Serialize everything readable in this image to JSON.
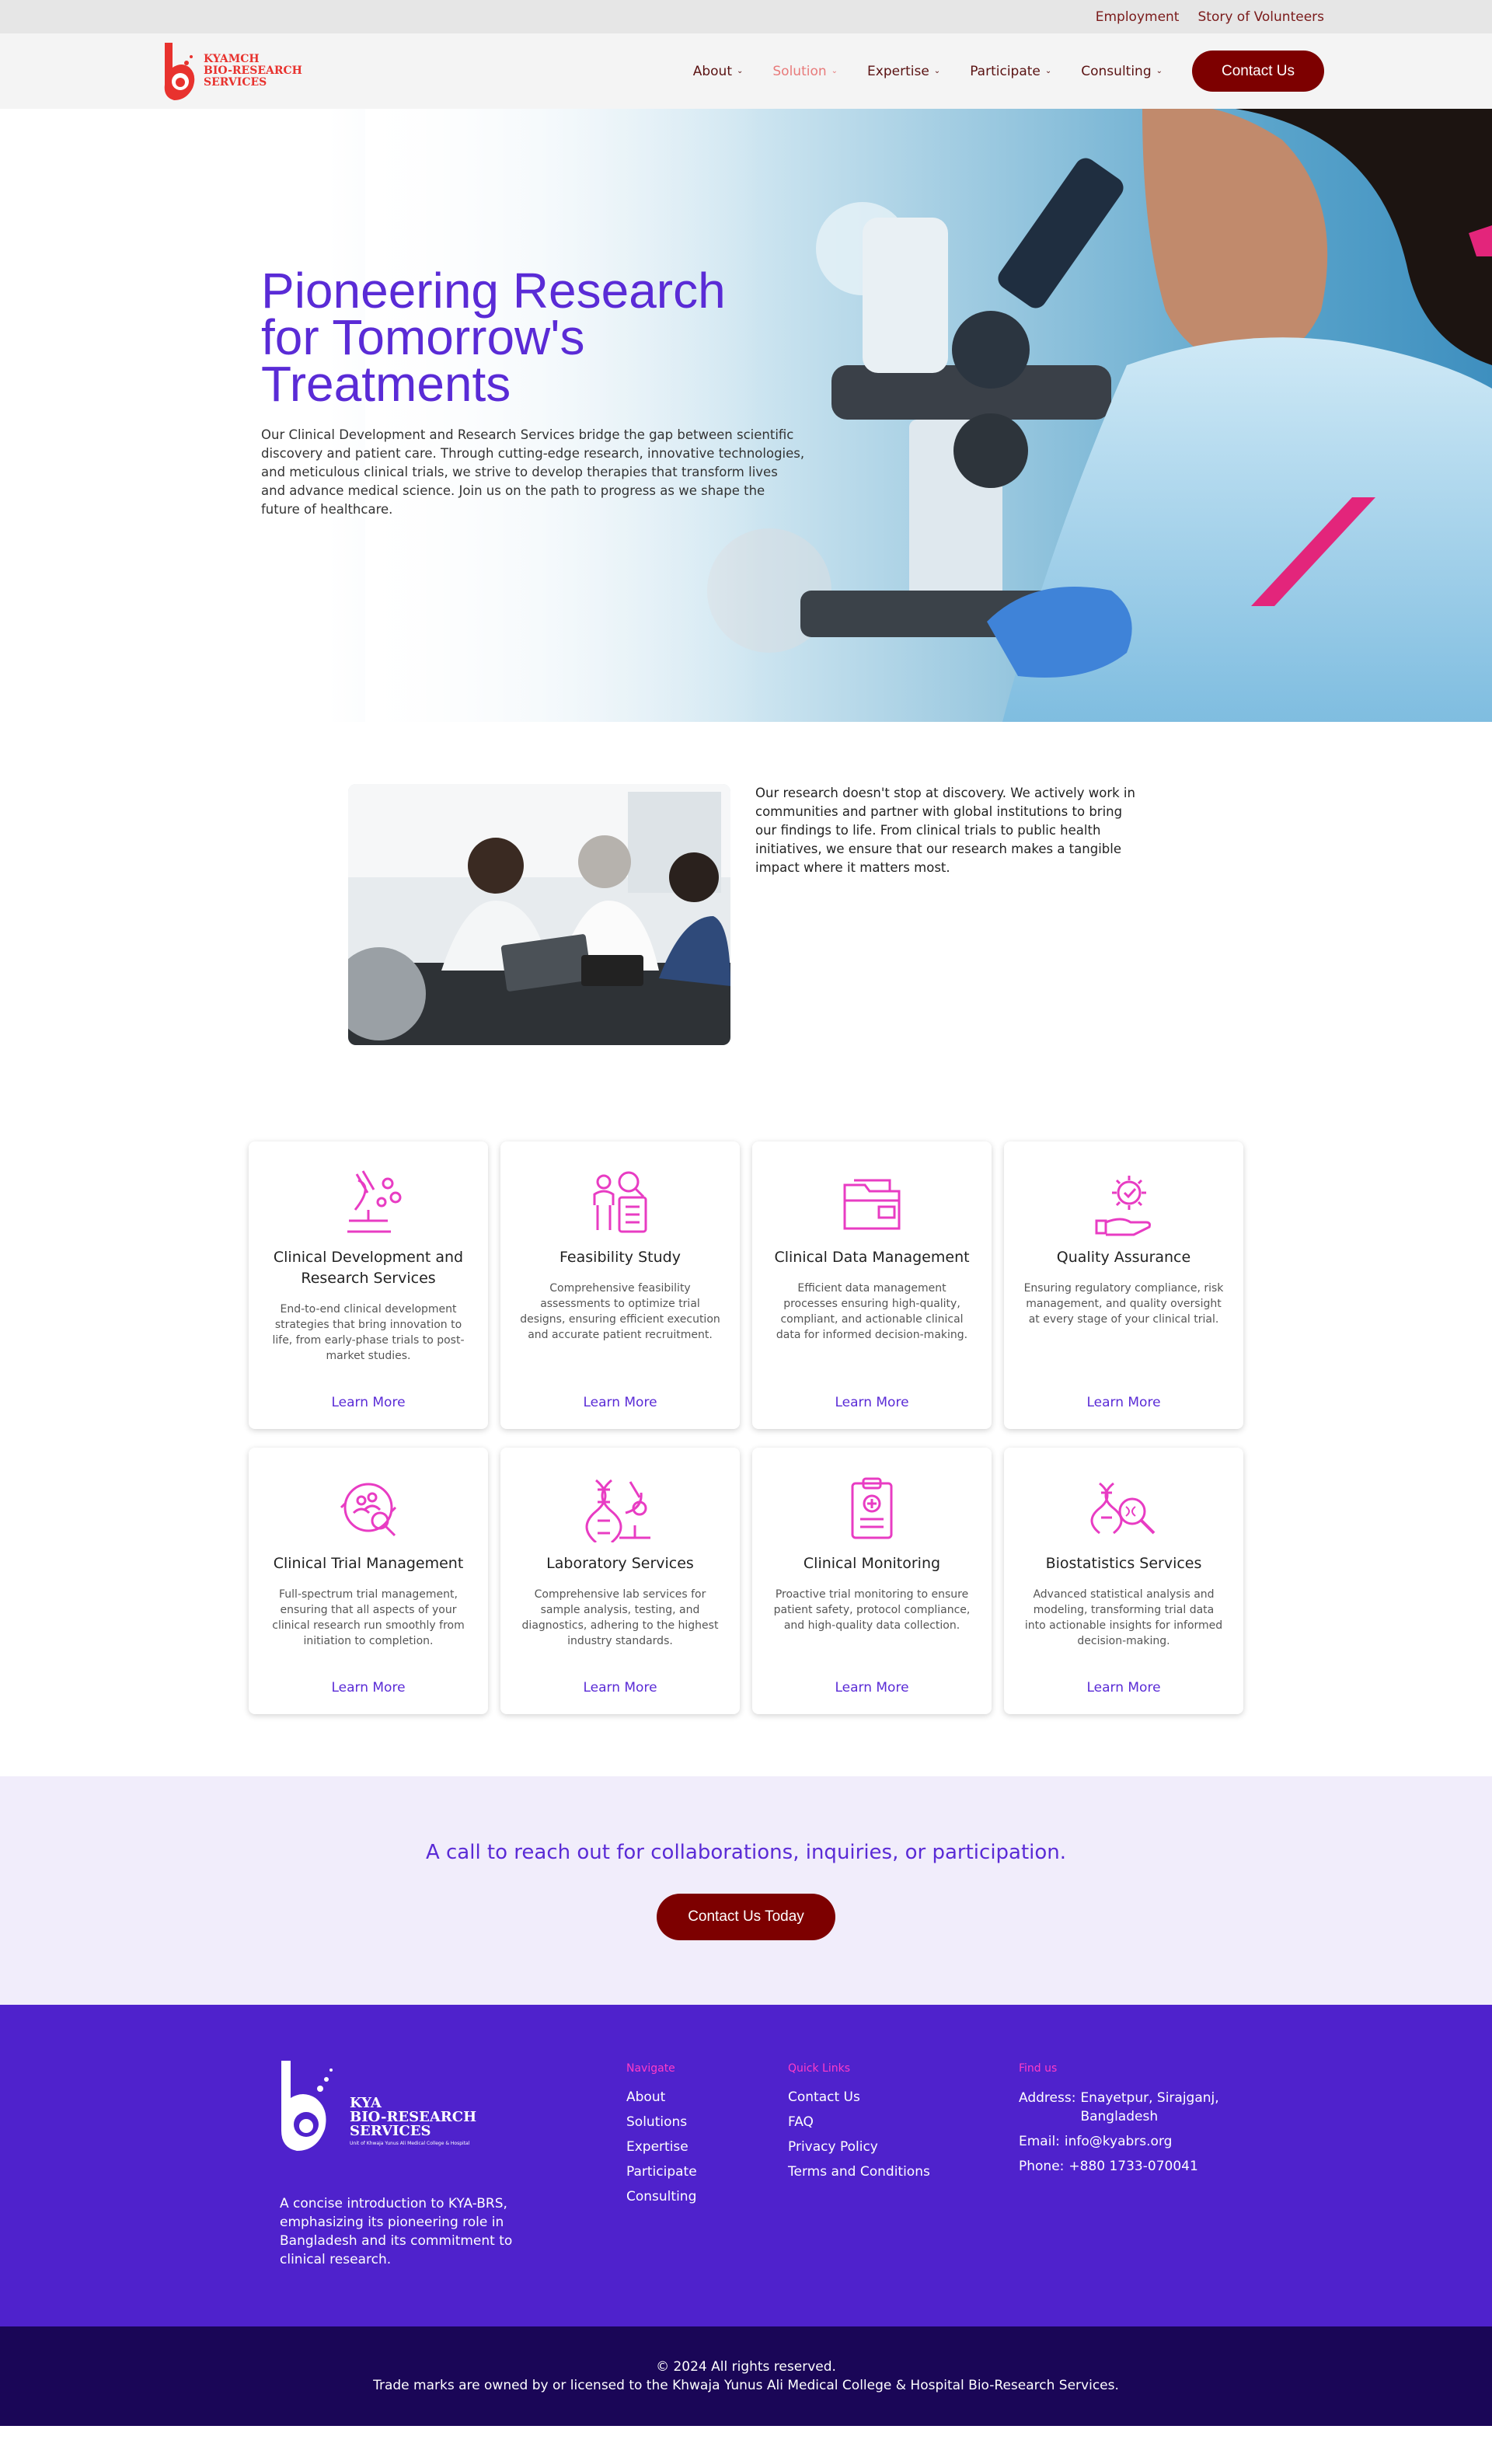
{
  "topbar": {
    "links": [
      "Employment",
      "Story of Volunteers"
    ]
  },
  "header": {
    "logo_lines": [
      "KYAMCH",
      "BIO-RESEARCH",
      "SERVICES"
    ],
    "nav": [
      {
        "label": "About",
        "active": false
      },
      {
        "label": "Solution",
        "active": true
      },
      {
        "label": "Expertise",
        "active": false
      },
      {
        "label": "Participate",
        "active": false
      },
      {
        "label": "Consulting",
        "active": false
      }
    ],
    "contact_label": "Contact Us"
  },
  "hero": {
    "title_lines": [
      "Pioneering Research",
      "for Tomorrow's",
      "Treatments"
    ],
    "body": "Our Clinical Development and Research Services bridge the gap between scientific discovery and patient care. Through cutting-edge research, innovative technologies, and meticulous clinical trials, we strive to develop therapies that transform lives and advance medical science. Join us on the path to progress as we shape the future of healthcare."
  },
  "intro": {
    "text": "Our research doesn't stop at discovery. We actively work in communities and partner with global institutions to bring our findings to life. From clinical trials to public health initiatives, we ensure that our research makes a tangible impact where it matters most."
  },
  "services": [
    {
      "icon": "microscope-icon",
      "title": "Clinical Development and Research Services",
      "desc": "End-to-end clinical development strategies that bring innovation to life, from early-phase trials to post-market studies.",
      "link": "Learn More"
    },
    {
      "icon": "feasibility-icon",
      "title": "Feasibility Study",
      "desc": "Comprehensive feasibility assessments to optimize trial designs, ensuring efficient execution and accurate patient recruitment.",
      "link": "Learn More"
    },
    {
      "icon": "folder-icon",
      "title": "Clinical Data Management",
      "desc": "Efficient data management processes ensuring high-quality, compliant, and actionable clinical data for informed decision-making.",
      "link": "Learn More"
    },
    {
      "icon": "gear-hand-icon",
      "title": "Quality Assurance",
      "desc": "Ensuring regulatory compliance, risk management, and quality oversight at every stage of your clinical trial.",
      "link": "Learn More"
    },
    {
      "icon": "trial-search-icon",
      "title": "Clinical Trial Management",
      "desc": "Full-spectrum trial management, ensuring that all aspects of your clinical research run smoothly from initiation to completion.",
      "link": "Learn More"
    },
    {
      "icon": "dna-microscope-icon",
      "title": "Laboratory Services",
      "desc": "Comprehensive lab services for sample analysis, testing, and diagnostics, adhering to the highest industry standards.",
      "link": "Learn More"
    },
    {
      "icon": "clipboard-icon",
      "title": "Clinical Monitoring",
      "desc": "Proactive trial monitoring to ensure patient safety, protocol compliance, and high-quality data collection.",
      "link": "Learn More"
    },
    {
      "icon": "dna-search-icon",
      "title": "Biostatistics Services",
      "desc": "Advanced statistical analysis and modeling, transforming trial data into actionable insights for informed decision-making.",
      "link": "Learn More"
    }
  ],
  "cta": {
    "text": "A call to reach out for collaborations, inquiries, or participation.",
    "button": "Contact Us Today"
  },
  "footer": {
    "logo_lines": [
      "KYA",
      "BIO-RESEARCH",
      "SERVICES"
    ],
    "logo_sub": "Unit of Khwaja Yunus Ali Medical College & Hospital",
    "intro": "A concise introduction to KYA-BRS, emphasizing its pioneering role in Bangladesh and its commitment to clinical research.",
    "navigate_title": "Navigate",
    "navigate": [
      "About",
      "Solutions",
      "Expertise",
      "Participate",
      "Consulting"
    ],
    "quick_title": "Quick Links",
    "quick": [
      "Contact Us",
      "FAQ",
      "Privacy Policy",
      "Terms and Conditions"
    ],
    "find_title": "Find us",
    "address_label": "Address:",
    "address": "Enayetpur, Sirajganj, Bangladesh",
    "email_label": "Email:",
    "email": "info@kyabrs.org",
    "phone_label": "Phone:",
    "phone": "+880 1733-070041"
  },
  "bottom": {
    "copyright": "© 2024  All rights reserved.",
    "trademark": "Trade marks are owned by or licensed to the Khwaja Yunus Ali Medical College & Hospital Bio-Research Services."
  },
  "colors": {
    "brand_red": "#7d0000",
    "purple": "#5a2bd6",
    "footer": "#4f22cc",
    "accent_pink": "#ff3cc8"
  }
}
